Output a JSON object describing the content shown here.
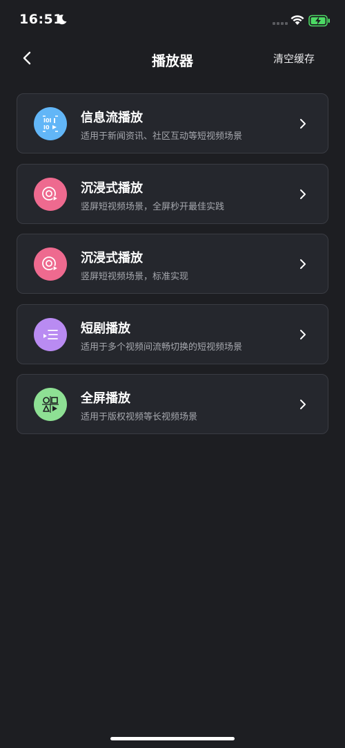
{
  "status_bar": {
    "time": "16:51",
    "icons": [
      "moon-icon",
      "signal-icon",
      "wifi-icon",
      "battery-charging-icon"
    ]
  },
  "nav": {
    "title": "播放器",
    "right_action": "清空缓存",
    "back_icon": "chevron-left-icon"
  },
  "items": [
    {
      "title": "信息流播放",
      "subtitle": "适用于新闻资讯、社区互动等短视频场景",
      "icon": "feed-player-icon",
      "color": "#62b6f7"
    },
    {
      "title": "沉浸式播放",
      "subtitle": "竖屏短视频场景，全屏秒开最佳实践",
      "icon": "immersive-player-icon",
      "color": "#ee6a8f"
    },
    {
      "title": "沉浸式播放",
      "subtitle": "竖屏短视频场景，标准实现",
      "icon": "immersive-player-icon",
      "color": "#ee6a8f"
    },
    {
      "title": "短剧播放",
      "subtitle": "适用于多个视频间流畅切换的短视频场景",
      "icon": "playlist-icon",
      "color": "#b98bf2"
    },
    {
      "title": "全屏播放",
      "subtitle": "适用于版权视频等长视频场景",
      "icon": "fullscreen-player-icon",
      "color": "#8ee094"
    }
  ]
}
